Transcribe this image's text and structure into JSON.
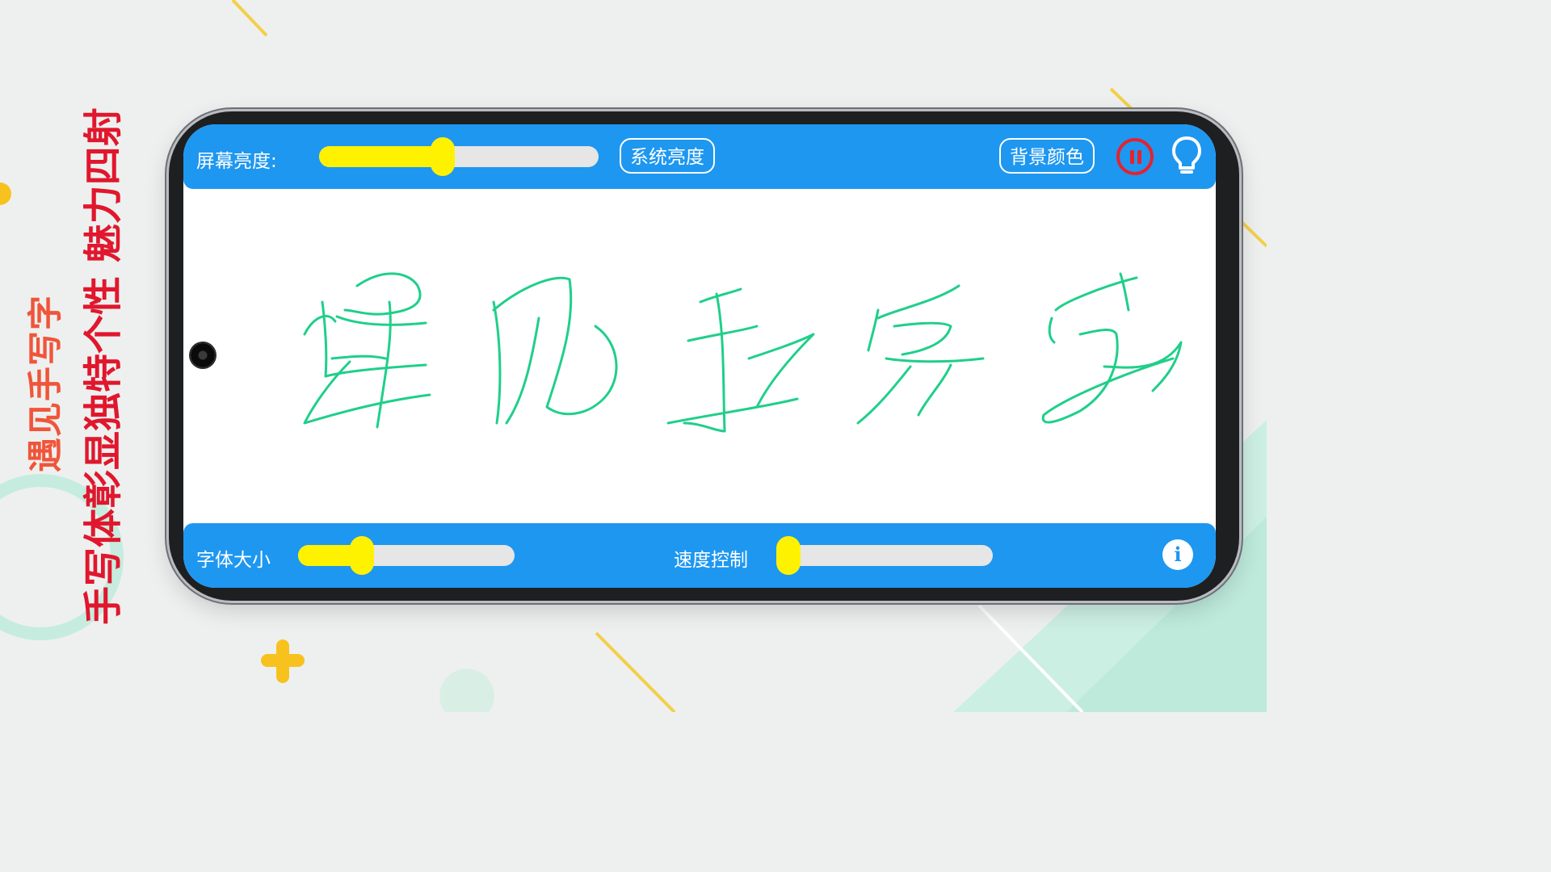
{
  "slogan": {
    "line1": "遇见手写字",
    "line2": "手写体彰显独特个性 魅力四射"
  },
  "top_bar": {
    "brightness_label": "屏幕亮度:",
    "brightness_level": 0.4,
    "system_brightness_button": "系统亮度",
    "background_color_button": "背景颜色",
    "pause_icon": "pause-circle-icon",
    "light_icon": "lightbulb-icon"
  },
  "bottom_bar": {
    "font_size_label": "字体大小",
    "font_size_level": 0.24,
    "speed_label": "速度控制",
    "speed_level": 0.0,
    "info_icon": "info-icon",
    "info_glyph": "i"
  },
  "canvas": {
    "stroke_color": "#1fcf8a"
  },
  "colors": {
    "bar": "#1e97f0",
    "slider_fill": "#fff200",
    "pause": "#e3232f",
    "slogan_main": "#e0172d",
    "slogan_sub": "#f0553a"
  }
}
